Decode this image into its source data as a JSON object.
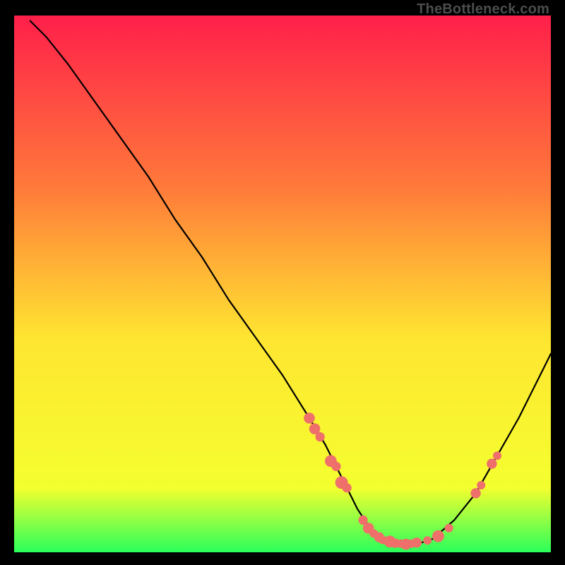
{
  "watermark": "TheBottleneck.com",
  "colors": {
    "gradient_top": "#ff1f4a",
    "gradient_mid_upper": "#ff7a3a",
    "gradient_mid": "#ffe531",
    "gradient_lower": "#f4ff2f",
    "gradient_bottom": "#2aff5a",
    "curve": "#000000",
    "marker": "#ef6f6a"
  },
  "chart_data": {
    "type": "line",
    "title": "",
    "xlabel": "",
    "ylabel": "",
    "xlim": [
      0,
      100
    ],
    "ylim": [
      0,
      100
    ],
    "grid": false,
    "series": [
      {
        "name": "bottleneck-curve",
        "x": [
          3,
          6,
          10,
          15,
          20,
          25,
          30,
          35,
          40,
          45,
          50,
          55,
          58,
          60,
          62,
          64,
          66,
          68,
          70,
          72,
          75,
          78,
          82,
          86,
          90,
          94,
          98,
          100
        ],
        "values": [
          99,
          96,
          91,
          84,
          77,
          70,
          62,
          55,
          47,
          40,
          33,
          25,
          20,
          16,
          12,
          8,
          5,
          3,
          2,
          1.5,
          1.5,
          2.5,
          6,
          11,
          18,
          25,
          33,
          37
        ]
      }
    ],
    "markers": [
      {
        "x": 55,
        "y": 25,
        "r": 1.3
      },
      {
        "x": 56,
        "y": 23,
        "r": 1.3
      },
      {
        "x": 57,
        "y": 21.5,
        "r": 1.1
      },
      {
        "x": 59,
        "y": 17,
        "r": 1.4
      },
      {
        "x": 60,
        "y": 16,
        "r": 1.1
      },
      {
        "x": 61,
        "y": 13,
        "r": 1.5
      },
      {
        "x": 62,
        "y": 12,
        "r": 1.1
      },
      {
        "x": 61.5,
        "y": 12.5,
        "r": 1.0
      },
      {
        "x": 65,
        "y": 6,
        "r": 1.1
      },
      {
        "x": 66,
        "y": 4.5,
        "r": 1.3
      },
      {
        "x": 67,
        "y": 3.5,
        "r": 1.0
      },
      {
        "x": 68,
        "y": 2.8,
        "r": 1.2
      },
      {
        "x": 68.7,
        "y": 2.3,
        "r": 1.0
      },
      {
        "x": 70,
        "y": 2,
        "r": 1.4
      },
      {
        "x": 71,
        "y": 1.7,
        "r": 1.1
      },
      {
        "x": 72,
        "y": 1.6,
        "r": 1.0
      },
      {
        "x": 73,
        "y": 1.5,
        "r": 1.3
      },
      {
        "x": 74,
        "y": 1.6,
        "r": 1.0
      },
      {
        "x": 75,
        "y": 1.8,
        "r": 1.2
      },
      {
        "x": 77,
        "y": 2.2,
        "r": 1.0
      },
      {
        "x": 79,
        "y": 3,
        "r": 1.4
      },
      {
        "x": 81,
        "y": 4.5,
        "r": 1.0
      },
      {
        "x": 86,
        "y": 11,
        "r": 1.2
      },
      {
        "x": 87,
        "y": 12.5,
        "r": 1.0
      },
      {
        "x": 89,
        "y": 16.5,
        "r": 1.2
      },
      {
        "x": 90,
        "y": 18,
        "r": 1.0
      }
    ]
  }
}
